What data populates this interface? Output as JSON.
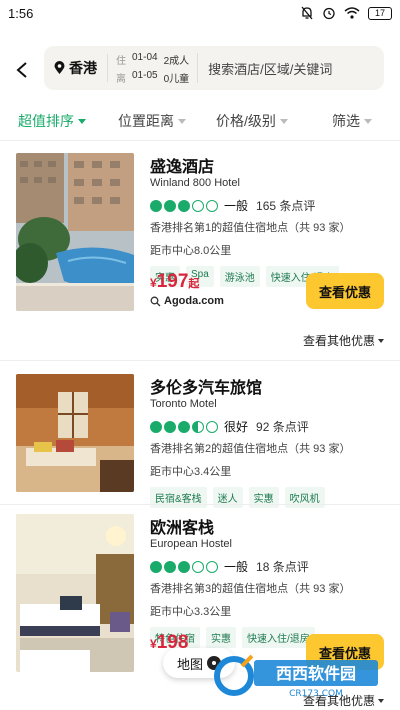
{
  "status": {
    "time": "1:56",
    "battery": "17"
  },
  "search": {
    "city": "香港",
    "checkin_label": "住",
    "checkin": "01-04",
    "checkout_label": "离",
    "checkout": "01-05",
    "adults": "2成人",
    "children": "0儿童",
    "keyword_placeholder": "搜索酒店/区域/关键词"
  },
  "filters": [
    {
      "label": "超值排序"
    },
    {
      "label": "位置距离"
    },
    {
      "label": "价格/级别"
    },
    {
      "label": "筛选"
    }
  ],
  "hotels": [
    {
      "name": "盛逸酒店",
      "ename": "Winland 800 Hotel",
      "rating_label": "一般",
      "reviews": "165 条点评",
      "rank": "香港排名第1的超值住宿地点（共 93 家）",
      "distance": "距市中心8.0公里",
      "tags": [
        "实惠",
        "Spa",
        "游泳池",
        "快速入住/退房"
      ],
      "price_currency": "¥",
      "price": "197",
      "price_suffix": "起",
      "provider": "Agoda.com",
      "deal_label": "查看优惠",
      "more_label": "查看其他优惠"
    },
    {
      "name": "多伦多汽车旅馆",
      "ename": "Toronto Motel",
      "rating_label": "很好",
      "reviews": "92 条点评",
      "rank": "香港排名第2的超值住宿地点（共 93 家）",
      "distance": "距市中心3.4公里",
      "tags": [
        "民宿&客栈",
        "迷人",
        "实惠",
        "吹风机"
      ]
    },
    {
      "name": "欧洲客栈",
      "ename": "European Hostel",
      "rating_label": "一般",
      "reviews": "18 条点评",
      "rank": "香港排名第3的超值住宿地点（共 93 家）",
      "distance": "距市中心3.3公里",
      "tags": [
        "特色住宿",
        "实惠",
        "快速入住/退房"
      ],
      "price_currency": "¥",
      "price": "198",
      "deal_label": "查看优惠",
      "more_label": "查看其他优惠"
    }
  ],
  "map_button": "地图",
  "watermark": {
    "brand": "西西软件园",
    "url": "CR173.COM"
  },
  "colors": {
    "accent": "#1aab6a",
    "price": "#d9263c",
    "button": "#fdc72f"
  }
}
